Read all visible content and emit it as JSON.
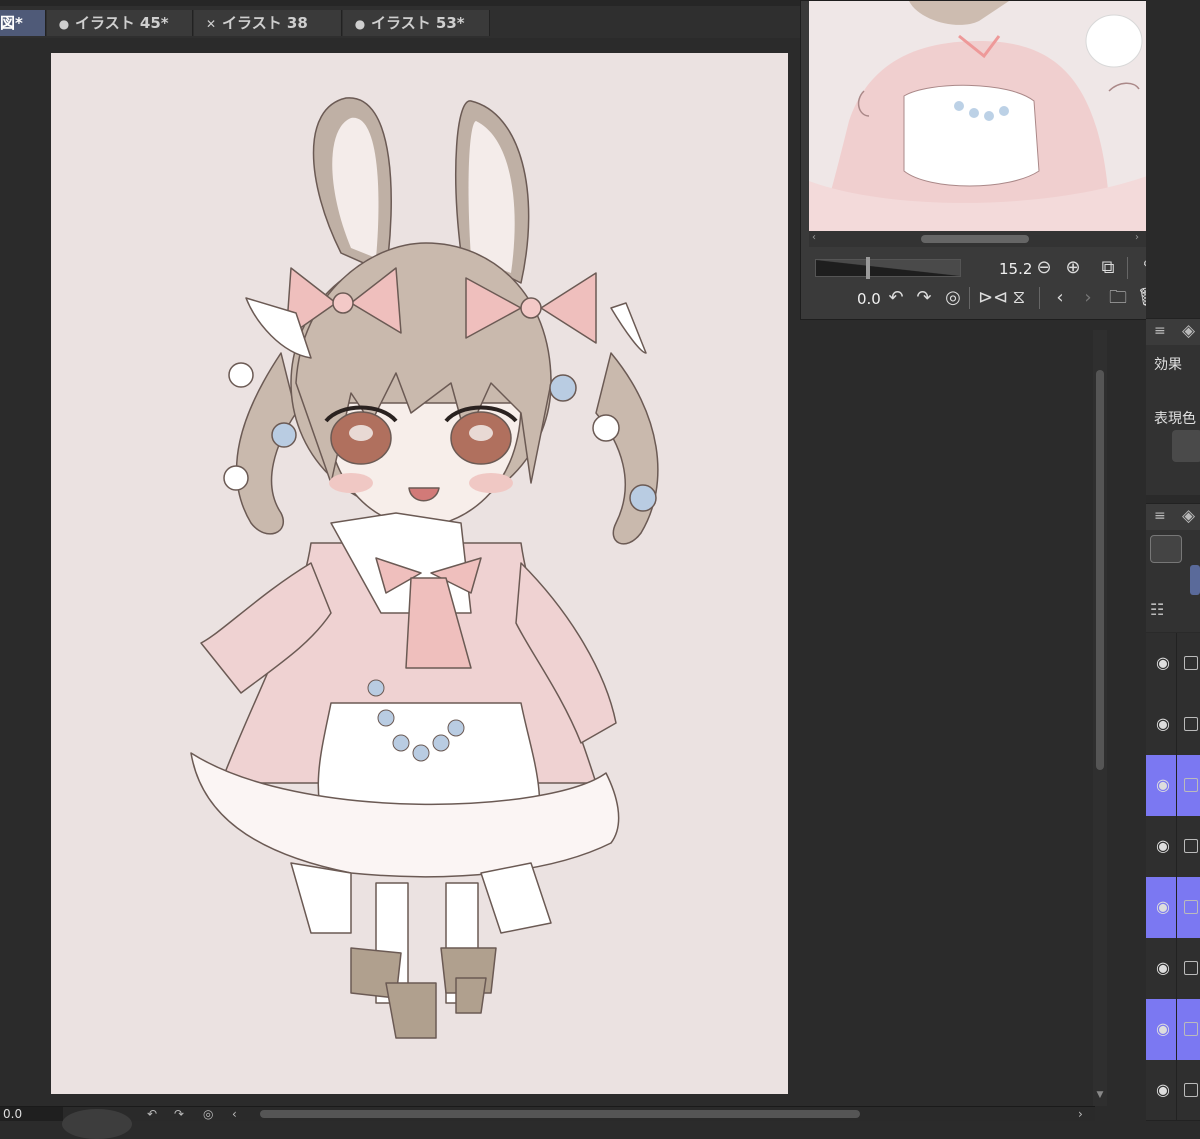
{
  "tabs": [
    {
      "label": "図*",
      "marker": "",
      "active": true
    },
    {
      "label": "イラスト 45*",
      "marker": "●",
      "active": false
    },
    {
      "label": "イラスト 38",
      "marker": "✕",
      "active": false
    },
    {
      "label": "イラスト 53*",
      "marker": "●",
      "active": false
    }
  ],
  "navigator": {
    "zoom": "15.2",
    "rotation": "0.0"
  },
  "panels": {
    "effect_label": "効果",
    "expression_label": "表現色"
  },
  "status": {
    "zoom_field": "0.0"
  },
  "layers": [
    {
      "selected": false
    },
    {
      "selected": false
    },
    {
      "selected": true
    },
    {
      "selected": false
    },
    {
      "selected": true
    },
    {
      "selected": false
    },
    {
      "selected": true
    },
    {
      "selected": false
    }
  ],
  "colors": {
    "accent": "#7b78f2",
    "active_tab": "#4f5a78",
    "paper": "#ebe2e1"
  }
}
